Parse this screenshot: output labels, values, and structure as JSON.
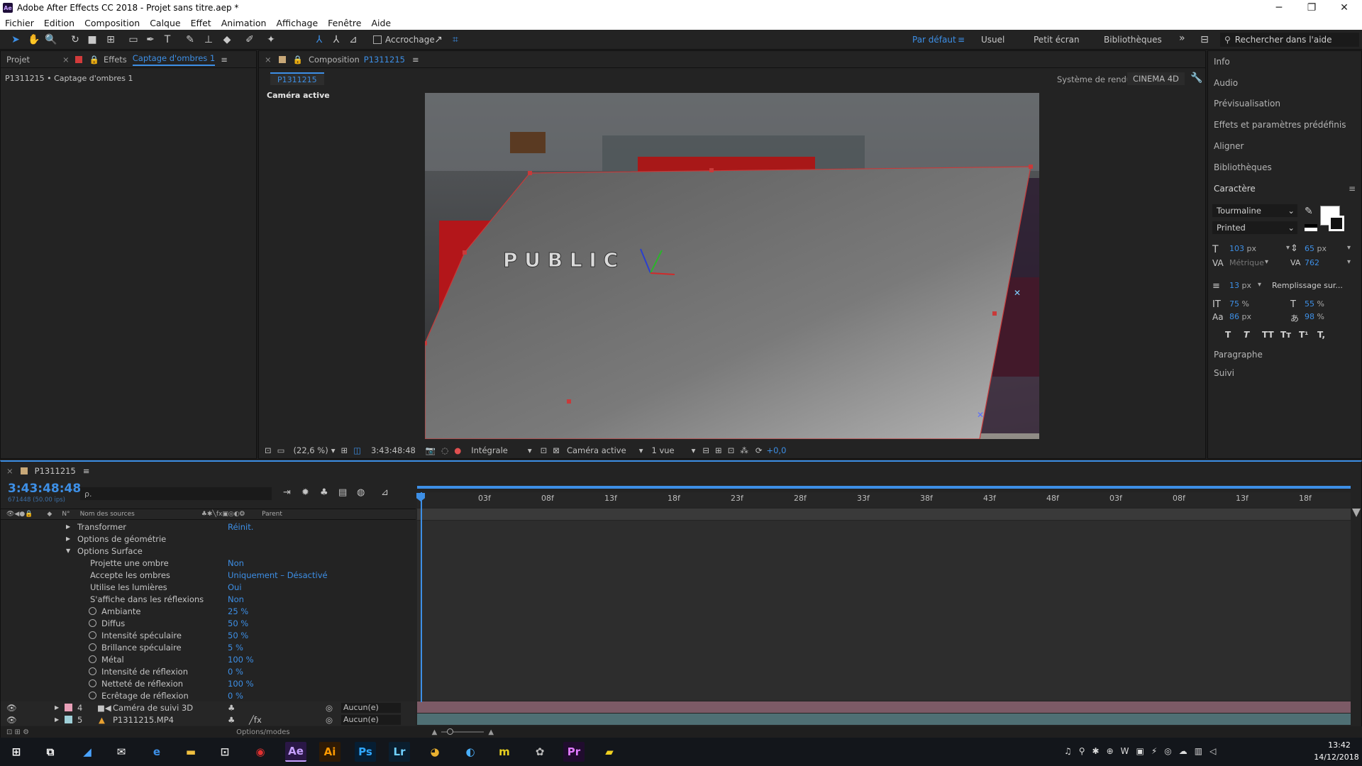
{
  "window": {
    "title": "Adobe After Effects CC 2018 - Projet sans titre.aep *",
    "app_badge": "Ae",
    "minimize": "─",
    "maximize": "❐",
    "close": "✕"
  },
  "menu": [
    "Fichier",
    "Edition",
    "Composition",
    "Calque",
    "Effet",
    "Animation",
    "Affichage",
    "Fenêtre",
    "Aide"
  ],
  "toolbar": {
    "snapping_label": "Accrochage",
    "workspaces": [
      "Par défaut",
      "Usuel",
      "Petit écran",
      "Bibliothèques"
    ],
    "active_workspace": "Par défaut",
    "more": "»",
    "search_placeholder": "Rechercher dans l'aide"
  },
  "left_panel": {
    "tab_project": "Projet",
    "tab_effects_prefix": "Effets",
    "tab_effects_name": "Captage d'ombres 1",
    "breadcrumb": "P1311215 • Captage d'ombres 1"
  },
  "comp_panel": {
    "tab_label": "Composition",
    "tab_name": "P1311215",
    "sub_tab": "P1311215",
    "renderer_label": "Système de rendu :",
    "renderer_value": "CINEMA 4D",
    "active_camera_label": "Caméra active",
    "text_in_scene": "P U B L I C"
  },
  "viewer_controls": {
    "zoom": "(22,6 %)",
    "timecode": "3:43:48:48",
    "resolution": "Intégrale",
    "view": "Caméra active",
    "views_count": "1 vue",
    "exposure": "+0,0"
  },
  "right_panel": {
    "items": [
      "Info",
      "Audio",
      "Prévisualisation",
      "Effets et paramètres prédéfinis",
      "Aligner",
      "Bibliothèques"
    ],
    "character_title": "Caractère",
    "font_family": "Tourmaline",
    "font_style": "Printed",
    "font_size": "103",
    "leading": "65",
    "kerning": "Métrique",
    "tracking": "762",
    "stroke_width": "13",
    "stroke_mode": "Remplissage sur...",
    "vertical_scale": "75",
    "horizontal_scale": "55",
    "baseline_shift": "86",
    "tsume": "98",
    "style_buttons": [
      "T",
      "T",
      "TT",
      "Tт",
      "T¹",
      "T,"
    ],
    "paragraph": "Paragraphe",
    "tracking_panel": "Suivi",
    "unit_px": "px",
    "unit_pct": "%",
    "unit_pct_spaced": " %"
  },
  "timeline": {
    "tab_name": "P1311215",
    "timecode": "3:43:48:48",
    "frame_info": "671448 (50.00 ips)",
    "search_placeholder": "ρ.",
    "col_num": "N°",
    "col_source": "Nom des sources",
    "col_parent": "Parent",
    "ruler_ticks": [
      "03f",
      "08f",
      "13f",
      "18f",
      "23f",
      "28f",
      "33f",
      "38f",
      "43f",
      "48f",
      "03f",
      "08f",
      "13f",
      "18f"
    ],
    "properties": [
      {
        "name": "Transformer",
        "value": "Réinit.",
        "indent": 0,
        "stopwatch": false,
        "arrow": "▶"
      },
      {
        "name": "Options de géométrie",
        "value": "",
        "indent": 0,
        "stopwatch": false,
        "arrow": "▶"
      },
      {
        "name": "Options Surface",
        "value": "",
        "indent": 0,
        "stopwatch": false,
        "arrow": "▼"
      },
      {
        "name": "Projette une ombre",
        "value": "Non",
        "indent": 1,
        "stopwatch": false,
        "arrow": ""
      },
      {
        "name": "Accepte les ombres",
        "value": "Uniquement – Désactivé",
        "indent": 1,
        "stopwatch": false,
        "arrow": ""
      },
      {
        "name": "Utilise les lumières",
        "value": "Oui",
        "indent": 1,
        "stopwatch": false,
        "arrow": ""
      },
      {
        "name": "S'affiche dans les réflexions",
        "value": "Non",
        "indent": 1,
        "stopwatch": false,
        "arrow": ""
      },
      {
        "name": "Ambiante",
        "value": "25 %",
        "indent": 1,
        "stopwatch": true,
        "arrow": ""
      },
      {
        "name": "Diffus",
        "value": "50 %",
        "indent": 1,
        "stopwatch": true,
        "arrow": ""
      },
      {
        "name": "Intensité spéculaire",
        "value": "50 %",
        "indent": 1,
        "stopwatch": true,
        "arrow": ""
      },
      {
        "name": "Brillance spéculaire",
        "value": "5 %",
        "indent": 1,
        "stopwatch": true,
        "arrow": ""
      },
      {
        "name": "Métal",
        "value": "100 %",
        "indent": 1,
        "stopwatch": true,
        "arrow": ""
      },
      {
        "name": "Intensité de réflexion",
        "value": "0 %",
        "indent": 1,
        "stopwatch": true,
        "arrow": ""
      },
      {
        "name": "Netteté de réflexion",
        "value": "100 %",
        "indent": 1,
        "stopwatch": true,
        "arrow": ""
      },
      {
        "name": "Ecrêtage de réflexion",
        "value": "0 %",
        "indent": 1,
        "stopwatch": true,
        "arrow": ""
      }
    ],
    "layers": [
      {
        "num": "4",
        "name": "Caméra de suivi 3D",
        "parent": "Aucun(e)",
        "color": "#e8a0b8"
      },
      {
        "num": "5",
        "name": "P1311215.MP4",
        "parent": "Aucun(e)",
        "color": "#9fd0d8"
      }
    ],
    "footer_label": "Options/modes"
  },
  "taskbar": {
    "apps": [
      "Ae",
      "Ai",
      "Ps",
      "Lr",
      "Pr"
    ],
    "time": "13:42",
    "date": "14/12/2018"
  },
  "colors": {
    "accent": "#3d8fe6",
    "panel_bg": "#232323",
    "ae_purple": "#c6a0ff"
  }
}
